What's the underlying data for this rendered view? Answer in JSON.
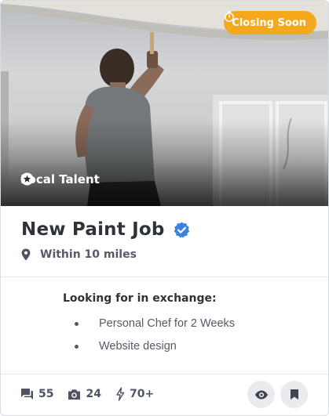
{
  "badge": {
    "label": "Closing Soon",
    "icon": "stopwatch-icon",
    "color": "#f4a81d"
  },
  "hero": {
    "tag_label": "Local Talent",
    "tag_icon": "star-circle-icon"
  },
  "job": {
    "title": "New Paint Job",
    "verified_icon": "verified-check-icon",
    "verified_color": "#3b82e0",
    "location_icon": "map-pin-icon",
    "location": "Within 10 miles"
  },
  "exchange": {
    "heading": "Looking for in exchange:",
    "items": [
      "Personal Chef for 2 Weeks",
      "Website design"
    ]
  },
  "stats": [
    {
      "icon": "comment-icon",
      "value": "55"
    },
    {
      "icon": "camera-icon",
      "value": "24"
    },
    {
      "icon": "bolt-icon",
      "value": "70+"
    }
  ],
  "actions": [
    {
      "icon": "eye-icon"
    },
    {
      "icon": "bookmark-icon"
    }
  ]
}
